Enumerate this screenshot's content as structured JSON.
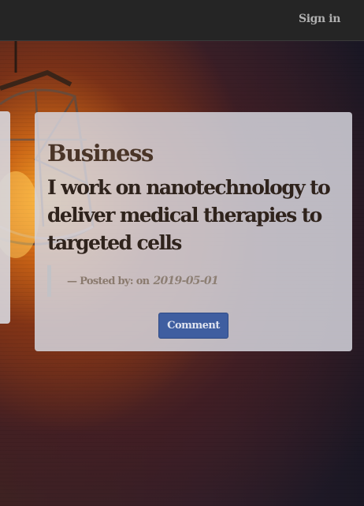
{
  "nav": {
    "signin_label": "Sign in"
  },
  "post": {
    "category": "Business",
    "title": "I work on nanotechnology to deliver medical therapies to targeted cells",
    "posted_by_prefix": "— Posted by: on",
    "date": "2019-05-01",
    "comment_label": "Comment"
  },
  "colors": {
    "navbar": "#252525",
    "button": "#3f5ea0",
    "card": "#d4d4dc"
  },
  "icons": {
    "background": "pendant-lamp-illustration"
  }
}
